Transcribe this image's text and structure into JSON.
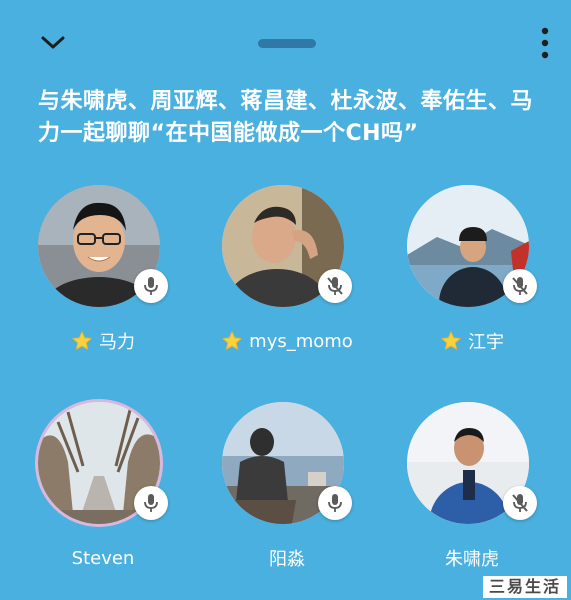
{
  "header": {
    "collapse_icon": "chevron-down-icon",
    "drag_handle_icon": "drag-handle-icon",
    "more_icon": "more-vertical-icon"
  },
  "room": {
    "title": "与朱啸虎、周亚辉、蒋昌建、杜永波、奉佑生、马力一起聊聊“在中国能做成一个CH吗”"
  },
  "speakers": [
    {
      "name": "马力",
      "moderator": true,
      "mic_on": true
    },
    {
      "name": "mys_momo",
      "moderator": true,
      "mic_on": false
    },
    {
      "name": "江宇",
      "moderator": true,
      "mic_on": false
    },
    {
      "name": "Steven",
      "moderator": false,
      "mic_on": true
    },
    {
      "name": "阳淼",
      "moderator": false,
      "mic_on": true
    },
    {
      "name": "朱啸虎",
      "moderator": false,
      "mic_on": false
    }
  ],
  "watermark": {
    "text": "三易生活"
  },
  "colors": {
    "background": "#4ab0df",
    "star": "#f7d23e",
    "mic_icon": "#5a5a5a"
  }
}
